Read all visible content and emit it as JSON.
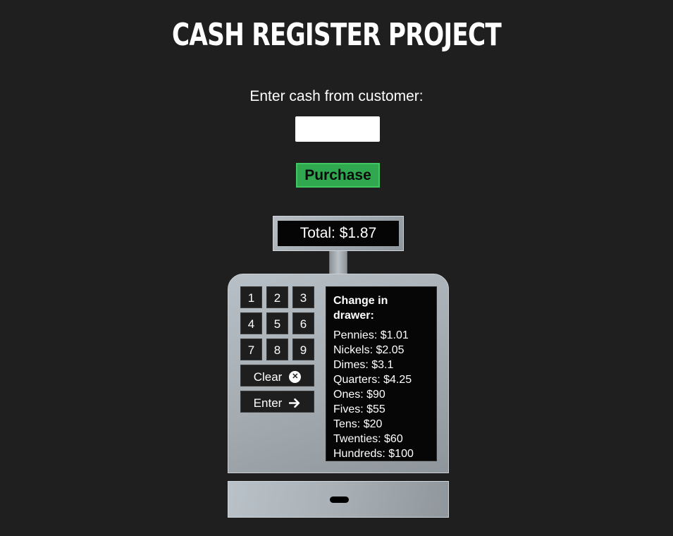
{
  "header": {
    "title": "CASH REGISTER PROJECT"
  },
  "form": {
    "prompt": "Enter cash from customer:",
    "cash_input_value": "",
    "cash_input_placeholder": "",
    "purchase_label": "Purchase"
  },
  "register": {
    "total_display": "Total: $1.87",
    "keys": [
      "1",
      "2",
      "3",
      "4",
      "5",
      "6",
      "7",
      "8",
      "9"
    ],
    "clear_label": "Clear",
    "clear_icon": "times-circle-icon",
    "enter_label": "Enter",
    "enter_icon": "arrow-right-icon",
    "drawer": {
      "heading": "Change in drawer:",
      "items": [
        "Pennies: $1.01",
        "Nickels: $2.05",
        "Dimes: $3.1",
        "Quarters: $4.25",
        "Ones: $90",
        "Fives: $55",
        "Tens: $20",
        "Twenties: $60",
        "Hundreds: $100"
      ]
    }
  },
  "colors": {
    "background": "#1f1f1f",
    "purchase_button": "#2fa84f",
    "register_metal": "#a7afb5",
    "screen": "#050505"
  }
}
